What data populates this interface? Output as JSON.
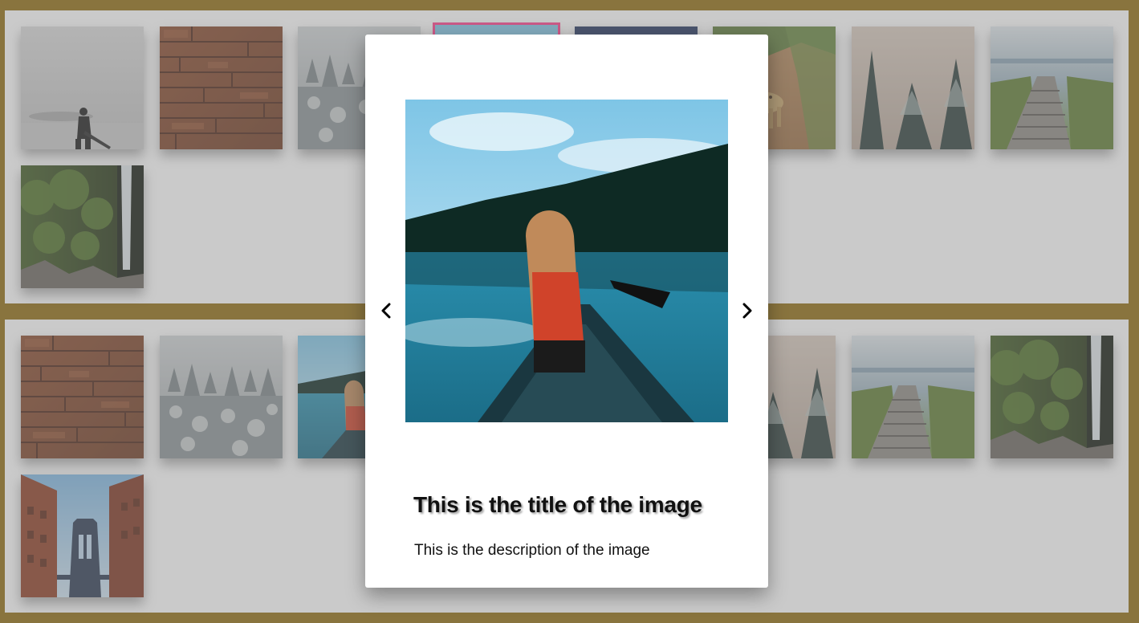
{
  "colors": {
    "page_background": "#8f6b0f",
    "gallery_background": "#ffffff",
    "active_outline": "#ff3d8b"
  },
  "gallery_top": {
    "thumbnails": [
      {
        "subject": "man with guitar on foggy beach"
      },
      {
        "subject": "wooden planks"
      },
      {
        "subject": "snowy forest"
      },
      {
        "subject": "woman in canoe on lake",
        "active": true
      },
      {
        "subject": "night sky"
      },
      {
        "subject": "leopard on dirt path"
      },
      {
        "subject": "misty pine trees"
      },
      {
        "subject": "wooden boardwalk to sea"
      },
      {
        "subject": "waterfall in forest"
      }
    ]
  },
  "gallery_bottom": {
    "thumbnails": [
      {
        "subject": "wooden planks"
      },
      {
        "subject": "snowy forest"
      },
      {
        "subject": "woman in canoe on lake"
      },
      {
        "subject": "night sky"
      },
      {
        "subject": "leopard on dirt path"
      },
      {
        "subject": "misty pine trees"
      },
      {
        "subject": "wooden boardwalk to sea"
      },
      {
        "subject": "waterfall in forest"
      },
      {
        "subject": "Manhattan bridge between brick buildings"
      }
    ]
  },
  "lightbox": {
    "image_subject": "woman in canoe on lake",
    "title": "This is the title of the image",
    "description": "This is the description of the image",
    "prev_icon": "chevron-left-icon",
    "next_icon": "chevron-right-icon"
  }
}
